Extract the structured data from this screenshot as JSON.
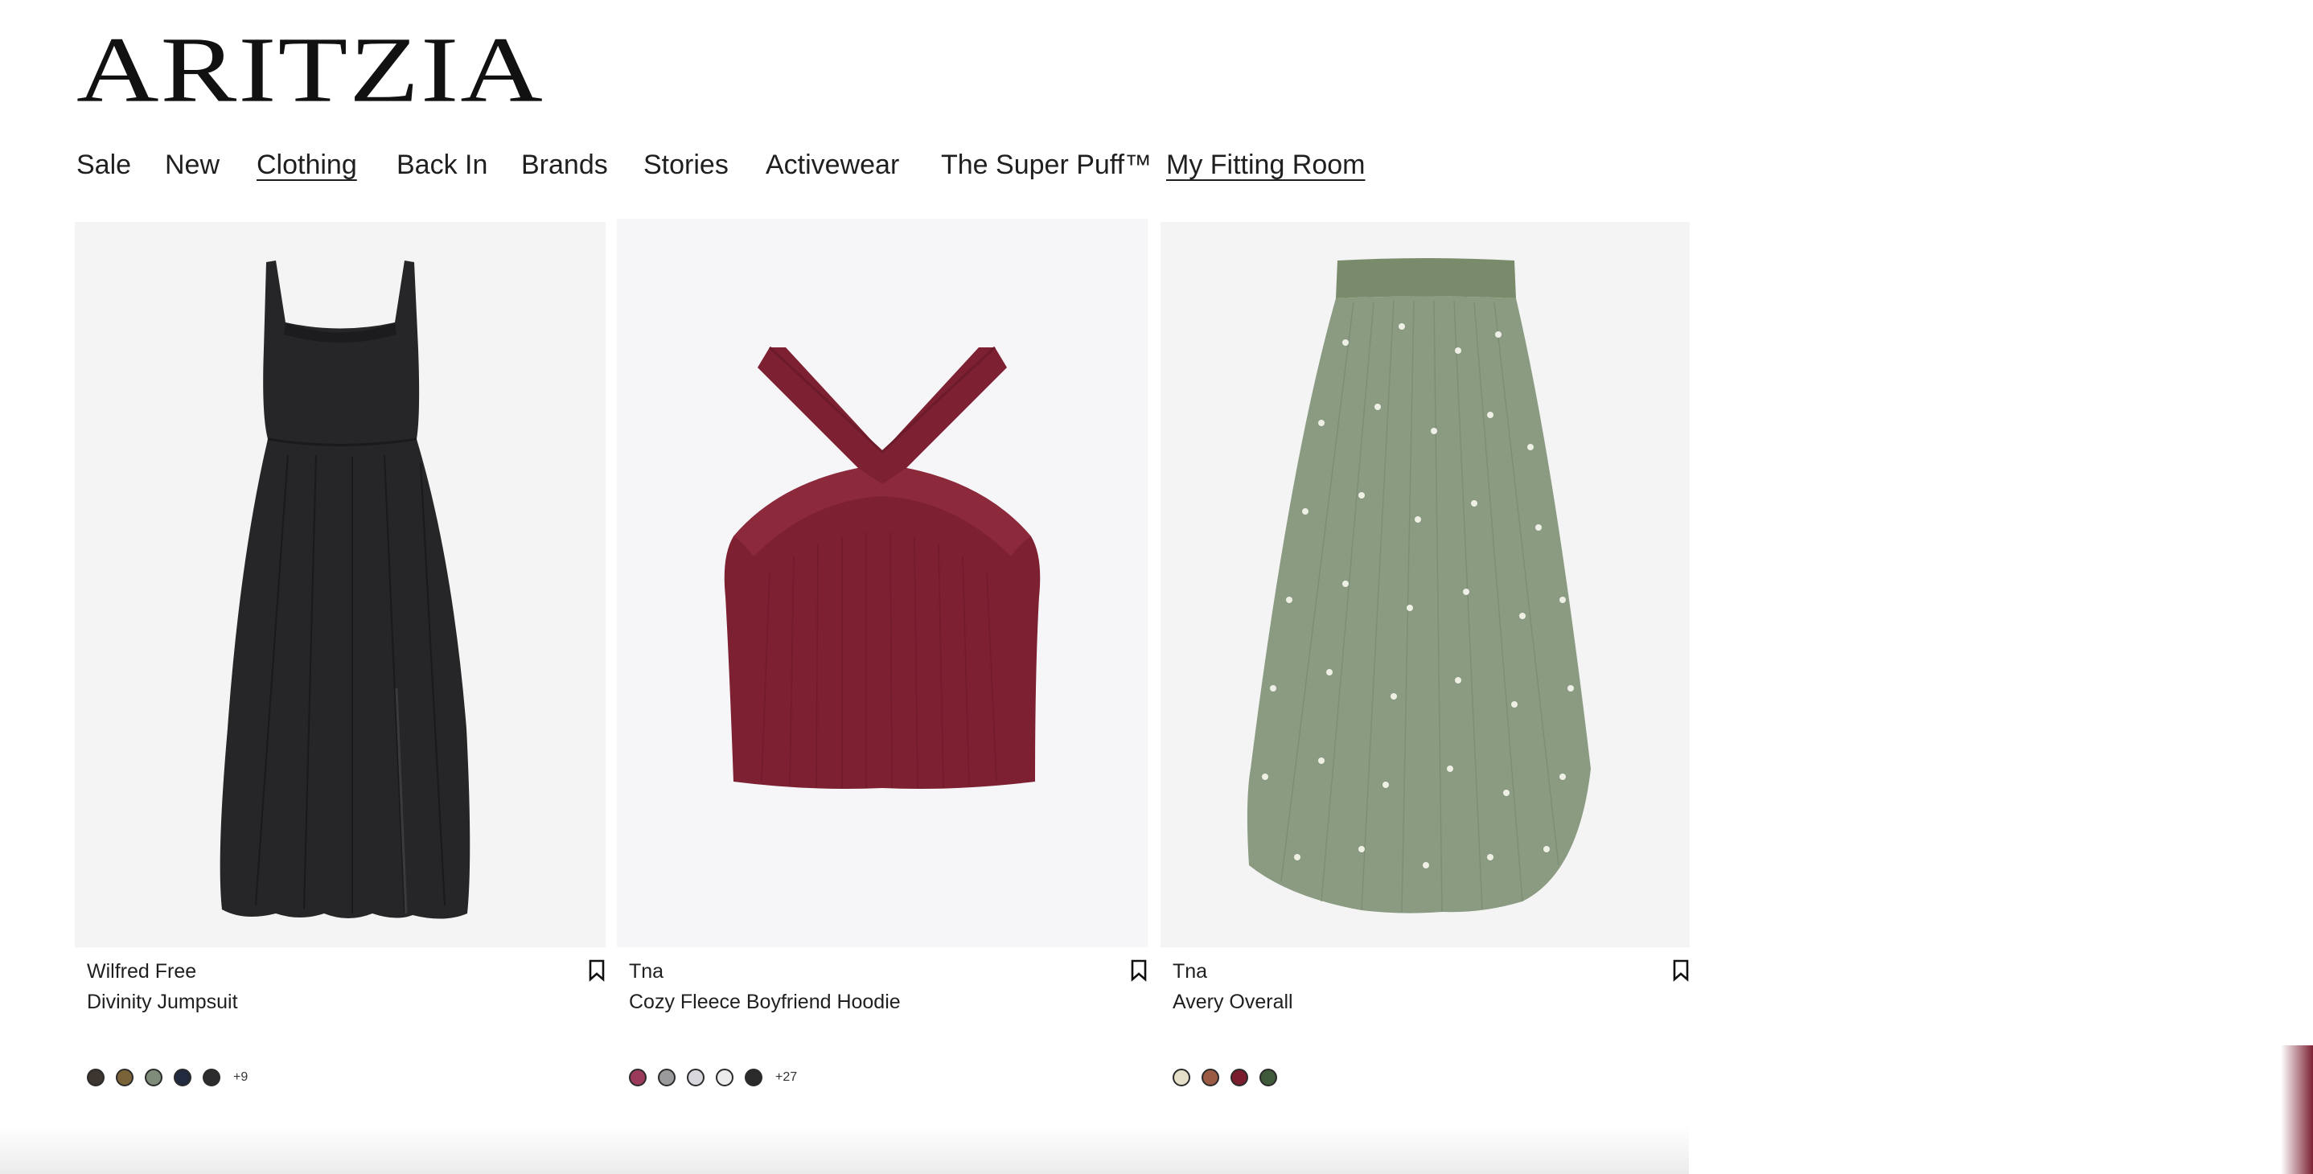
{
  "logo": "ARITZIA",
  "nav": {
    "items": [
      {
        "label": "Sale"
      },
      {
        "label": "New"
      },
      {
        "label": "Clothing"
      },
      {
        "label": "Back In"
      },
      {
        "label": "Brands"
      },
      {
        "label": "Stories"
      },
      {
        "label": "Activewear"
      },
      {
        "label": "The Super Puff™"
      },
      {
        "label": "My Fitting Room"
      }
    ]
  },
  "products": [
    {
      "brand": "Wilfred Free",
      "name": "Divinity Jumpsuit",
      "image": "black-midi-dress",
      "swatches": [
        "#3d3530",
        "#7a6338",
        "#7f8c7a",
        "#222a40",
        "#2c2c2e"
      ],
      "more": "+9"
    },
    {
      "brand": "Tna",
      "name": "Cozy Fleece Boyfriend Hoodie",
      "image": "burgundy-halter-top",
      "swatches": [
        "#9b3a5a",
        "#9a9a9c",
        "#d8d8dc",
        "#ececec",
        "#2a2a2a"
      ],
      "more": "+27"
    },
    {
      "brand": "Tna",
      "name": "Avery Overall",
      "image": "sage-floral-pleated-skirt",
      "swatches": [
        "#e6dfc7",
        "#9a5a44",
        "#7a1e2e",
        "#3f5a3a"
      ],
      "more": ""
    }
  ],
  "icons": {
    "bookmark": "bookmark-icon"
  }
}
